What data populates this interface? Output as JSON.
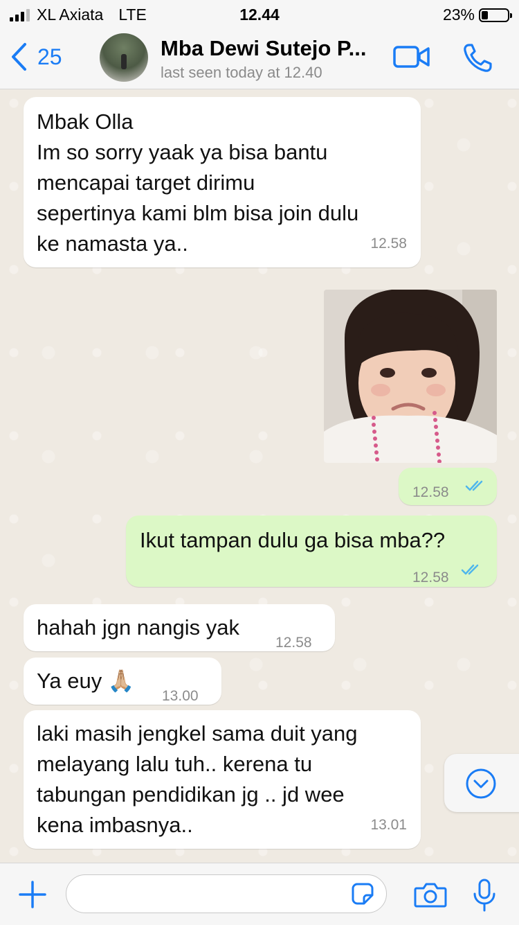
{
  "status_bar": {
    "carrier": "XL Axiata",
    "network": "LTE",
    "time": "12.44",
    "battery": "23%",
    "battery_level": 0.23
  },
  "header": {
    "back_count": "25",
    "contact_name": "Mba Dewi Sutejo P...",
    "last_seen": "last seen today at 12.40",
    "icons": {
      "back": "chevron-left-icon",
      "video": "video-call-icon",
      "call": "phone-icon"
    },
    "accent": "#1a7cf5"
  },
  "messages": [
    {
      "dir": "in",
      "lines": [
        "Mbak Olla",
        "Im so sorry yaak ya bisa bantu",
        "mencapai target dirimu",
        "sepertinya kami blm bisa join dulu",
        "ke namasta ya.."
      ],
      "time": "12.58"
    },
    {
      "dir": "out",
      "type": "image",
      "time": "12.58"
    },
    {
      "dir": "out",
      "text": "Ikut tampan dulu ga bisa mba??",
      "time": "12.58"
    },
    {
      "dir": "in",
      "text": "hahah jgn nangis yak",
      "time": "12.58"
    },
    {
      "dir": "in",
      "text": "Ya euy 🙏🏼",
      "time": "13.00"
    },
    {
      "dir": "in",
      "lines": [
        "laki masih jengkel sama duit yang",
        "melayang lalu tuh.. kerena tu",
        "tabungan pendidikan jg .. jd wee",
        "kena imbasnya.."
      ],
      "time": "13.01"
    }
  ],
  "colors": {
    "incoming": "#ffffff",
    "outgoing": "#dcf8c6",
    "read_ticks": "#4fb6ec",
    "background": "#efeae2"
  },
  "composer": {
    "icons": [
      "plus-icon",
      "sticker-icon",
      "camera-icon",
      "microphone-icon"
    ]
  }
}
